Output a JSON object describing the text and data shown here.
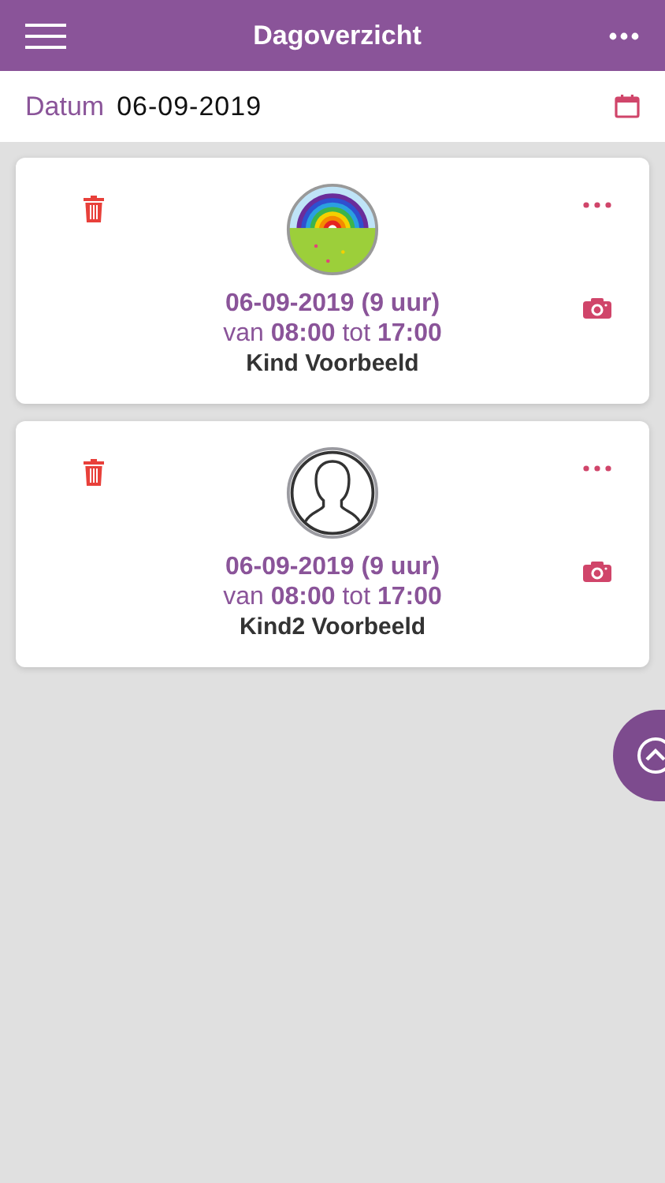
{
  "header": {
    "title": "Dagoverzicht"
  },
  "date_row": {
    "label": "Datum",
    "value": "06-09-2019"
  },
  "entries": [
    {
      "kind": "picture",
      "date": "06-09-2019 (9 uur)",
      "times": "van **08:00** tot **17:00**",
      "name": "Kind Voorbeeld"
    },
    {
      "kind": "silhouette",
      "date": "06-09-2019 (9 uur)",
      "times": "van **08:00** tot **17:00**",
      "name": "Kind2 Voorbeeld"
    }
  ]
}
